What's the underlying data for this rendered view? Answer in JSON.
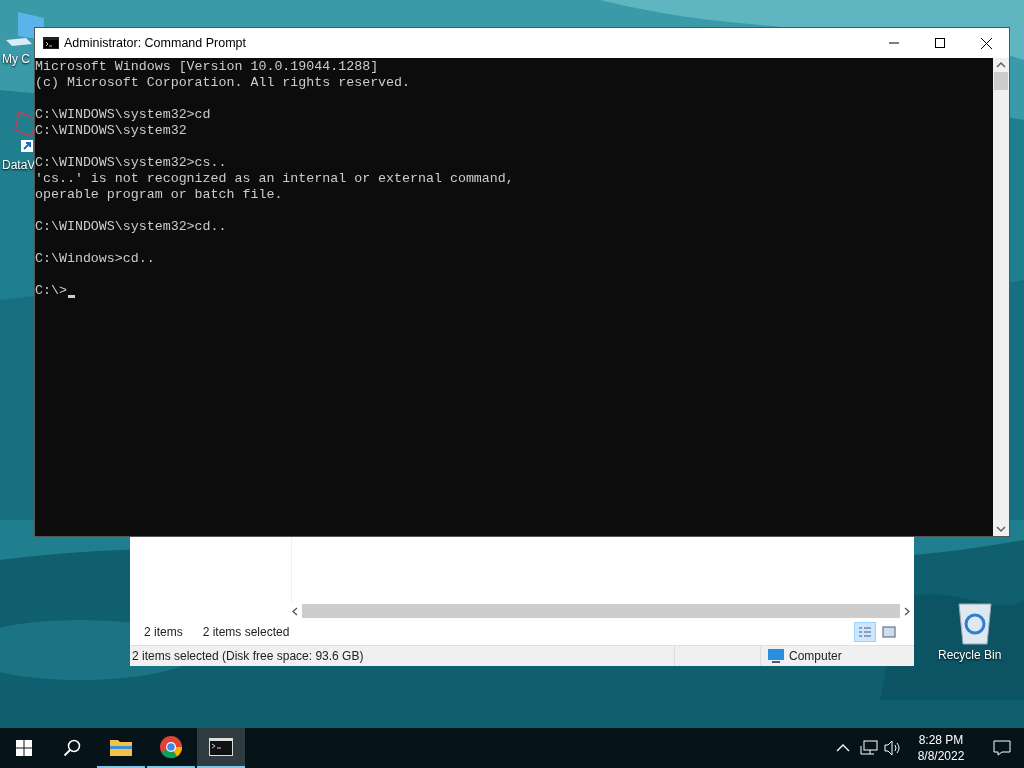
{
  "desktop_icons": [
    {
      "label": "My C",
      "kind": "computer"
    },
    {
      "label": "DataV",
      "kind": "shortcut"
    },
    {
      "label": "Recycle Bin",
      "kind": "recycle"
    }
  ],
  "explorer": {
    "status_items": "2 items",
    "status_selected": "2 items selected",
    "views": [
      {
        "kind": "details",
        "selected": true
      },
      {
        "kind": "preview",
        "selected": false
      }
    ],
    "status_bar": "2 items selected (Disk free space: 93.6 GB)",
    "location": "Computer"
  },
  "console": {
    "title": "Administrator: Command Prompt",
    "blocks": [
      [
        "Microsoft Windows [Version 10.0.19044.1288]",
        "(c) Microsoft Corporation. All rights reserved."
      ],
      [
        "C:\\WINDOWS\\system32>cd",
        "C:\\WINDOWS\\system32"
      ],
      [
        "C:\\WINDOWS\\system32>cs..",
        "'cs..' is not recognized as an internal or external command,",
        "operable program or batch file."
      ],
      [
        "C:\\WINDOWS\\system32>cd.."
      ],
      [
        "C:\\Windows>cd.."
      ],
      [
        "C:\\>"
      ]
    ]
  },
  "taskbar": {
    "apps": [
      {
        "kind": "explorer",
        "running": true,
        "selected": false
      },
      {
        "kind": "chrome",
        "running": true,
        "selected": false
      },
      {
        "kind": "console",
        "running": true,
        "selected": true
      }
    ],
    "time": "8:28 PM",
    "date": "8/8/2022"
  }
}
